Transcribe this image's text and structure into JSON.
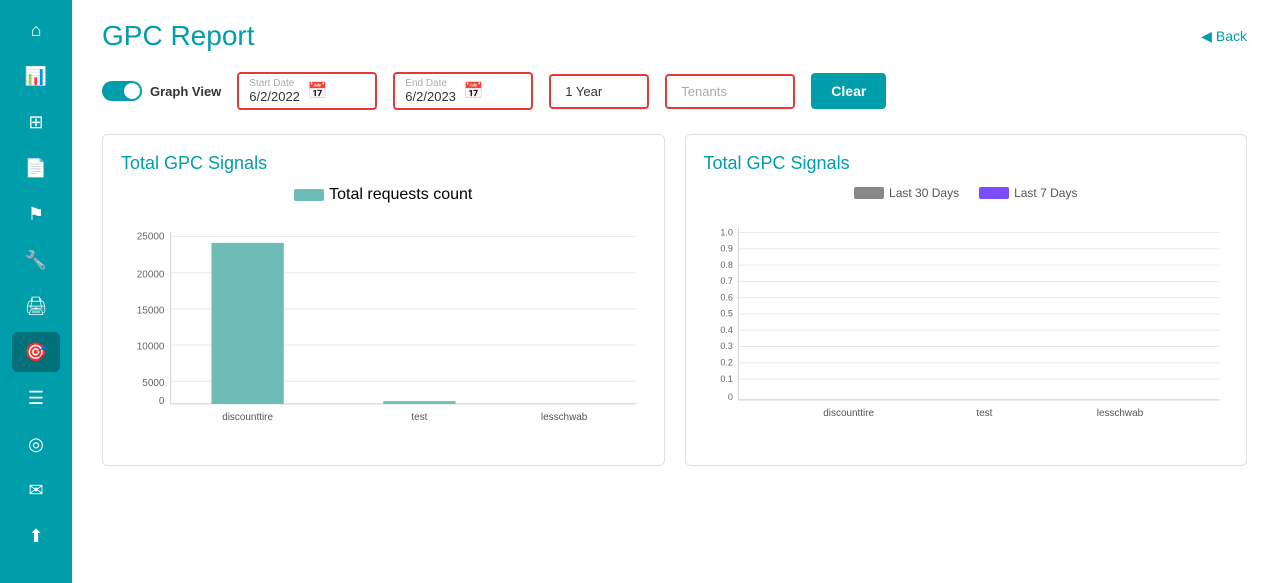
{
  "page": {
    "title": "GPC Report",
    "back_label": "Back"
  },
  "sidebar": {
    "items": [
      {
        "icon": "🏠",
        "name": "home"
      },
      {
        "icon": "📈",
        "name": "chart"
      },
      {
        "icon": "⊞",
        "name": "grid"
      },
      {
        "icon": "📄",
        "name": "document"
      },
      {
        "icon": "🚩",
        "name": "flag"
      },
      {
        "icon": "🔧",
        "name": "tools"
      },
      {
        "icon": "🖨",
        "name": "print"
      },
      {
        "icon": "🎯",
        "name": "target"
      },
      {
        "icon": "⊟",
        "name": "list"
      },
      {
        "icon": "⊙",
        "name": "circle"
      },
      {
        "icon": "✉",
        "name": "mail"
      },
      {
        "icon": "⬆",
        "name": "upload"
      }
    ]
  },
  "filters": {
    "graph_view_label": "Graph View",
    "start_date_label": "Start Date",
    "start_date_value": "6/2/2022",
    "end_date_label": "End Date",
    "end_date_value": "6/2/2023",
    "year_value": "1 Year",
    "tenants_placeholder": "Tenants",
    "clear_button": "Clear"
  },
  "left_chart": {
    "title": "Total GPC Signals",
    "legend_label": "Total requests count",
    "y_labels": [
      "25000",
      "20000",
      "15000",
      "10000",
      "5000",
      "0"
    ],
    "bars": [
      {
        "label": "discounttire",
        "height_pct": 94,
        "value": 23500
      },
      {
        "label": "test",
        "height_pct": 1.5,
        "value": 200
      },
      {
        "label": "lesschwab",
        "height_pct": 0,
        "value": 0
      }
    ]
  },
  "right_chart": {
    "title": "Total GPC Signals",
    "legend": [
      {
        "label": "Last 30 Days",
        "color": "#888888"
      },
      {
        "label": "Last 7 Days",
        "color": "#7c4dff"
      }
    ],
    "y_labels": [
      "1.0",
      "0.9",
      "0.8",
      "0.7",
      "0.6",
      "0.5",
      "0.4",
      "0.3",
      "0.2",
      "0.1",
      "0"
    ],
    "x_labels": [
      "discounttire",
      "test",
      "lesschwab"
    ]
  }
}
